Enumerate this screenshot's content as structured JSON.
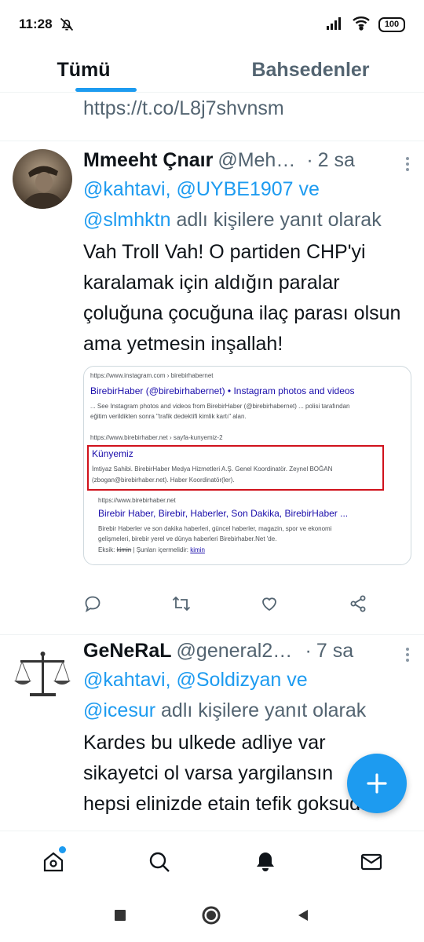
{
  "status_bar": {
    "time": "11:28",
    "battery": "100"
  },
  "tabs": [
    {
      "label": "Tümü",
      "active": true
    },
    {
      "label": "Bahsedenler",
      "active": false
    }
  ],
  "previous_tweet": {
    "link": "https://t.co/L8j7shvnsm"
  },
  "tweets": [
    {
      "name": "Mmeeht Çnaır",
      "handle": "@Meh…",
      "time": "2 sa",
      "reply_prefix": "",
      "reply_mentions_a": "@kahtavi, @UYBE1907",
      "reply_and": " ve ",
      "reply_mentions_b": "@slmhktn",
      "reply_suffix": " adlı kişilere yanıt olarak",
      "text": "Vah Troll Vah! O partiden CHP'yi karalamak için aldığın paralar çoluğuna çocuğuna ilaç parası olsun ama yetmesin inşallah!",
      "media": {
        "r1_url": "https://www.instagram.com › birebirhabernet",
        "r1_title": "BirebirHaber (@birebirhabernet) • Instagram photos and videos",
        "r1_snippet_1": "... See Instagram photos and videos from BirebirHaber (@birebirhabernet) ... polisi tarafından",
        "r1_snippet_2": "eğitim verildikten sonra \"trafik dedektifi kimlik kartı\" alan.",
        "r2_url": "https://www.birebirhaber.net › sayfa-kunyemiz-2",
        "r2_title": "Künyemiz",
        "r2_snippet_1": "İmtiyaz Sahibi. BirebirHaber Medya Hizmetleri A.Ş. Genel Koordinatör. Zeynel BOĞAN",
        "r2_snippet_2": "(zbogan@birebirhaber.net). Haber Koordinatör(ler).",
        "r3_url": "https://www.birebirhaber.net",
        "r3_title": "Birebir Haber, Birebir, Haberler, Son Dakika, BirebirHaber ...",
        "r3_snippet_1": "Birebir Haberler ve son dakika haberleri, güncel haberler, magazin, spor ve ekonomi",
        "r3_snippet_2": "gelişmeleri, birebir yerel ve dünya haberleri Birebirhaber.Net 'de.",
        "r3_missing_label": "Eksik:",
        "r3_missing_word": "kimin",
        "r3_must_include": "| Şunları içermelidir:",
        "r3_must_word": "kimin"
      }
    },
    {
      "name": "GeNeRaL",
      "handle": "@general20…",
      "time": "7 sa",
      "reply_mentions_a": "@kahtavi, @Soldizyan",
      "reply_and": " ve ",
      "reply_mentions_b": "@icesur",
      "reply_suffix": " adlı kişilere yanıt olarak",
      "text_line1": "Kardes bu ulkede adliye var",
      "text_line2": "sikayetci ol varsa yargilansın",
      "text_line3": "hepsi elinizde etain tefik goksuda"
    }
  ],
  "icons": {
    "reply": "reply-icon",
    "retweet": "retweet-icon",
    "like": "like-icon",
    "share": "share-icon",
    "compose": "compose-plus-icon",
    "home": "home-icon",
    "search": "search-icon",
    "notifications": "bell-icon",
    "messages": "mail-icon"
  },
  "colors": {
    "accent": "#1d9bf0",
    "secondary_text": "#536471",
    "red_box": "#d0121c",
    "link_title": "#1a0dab"
  }
}
